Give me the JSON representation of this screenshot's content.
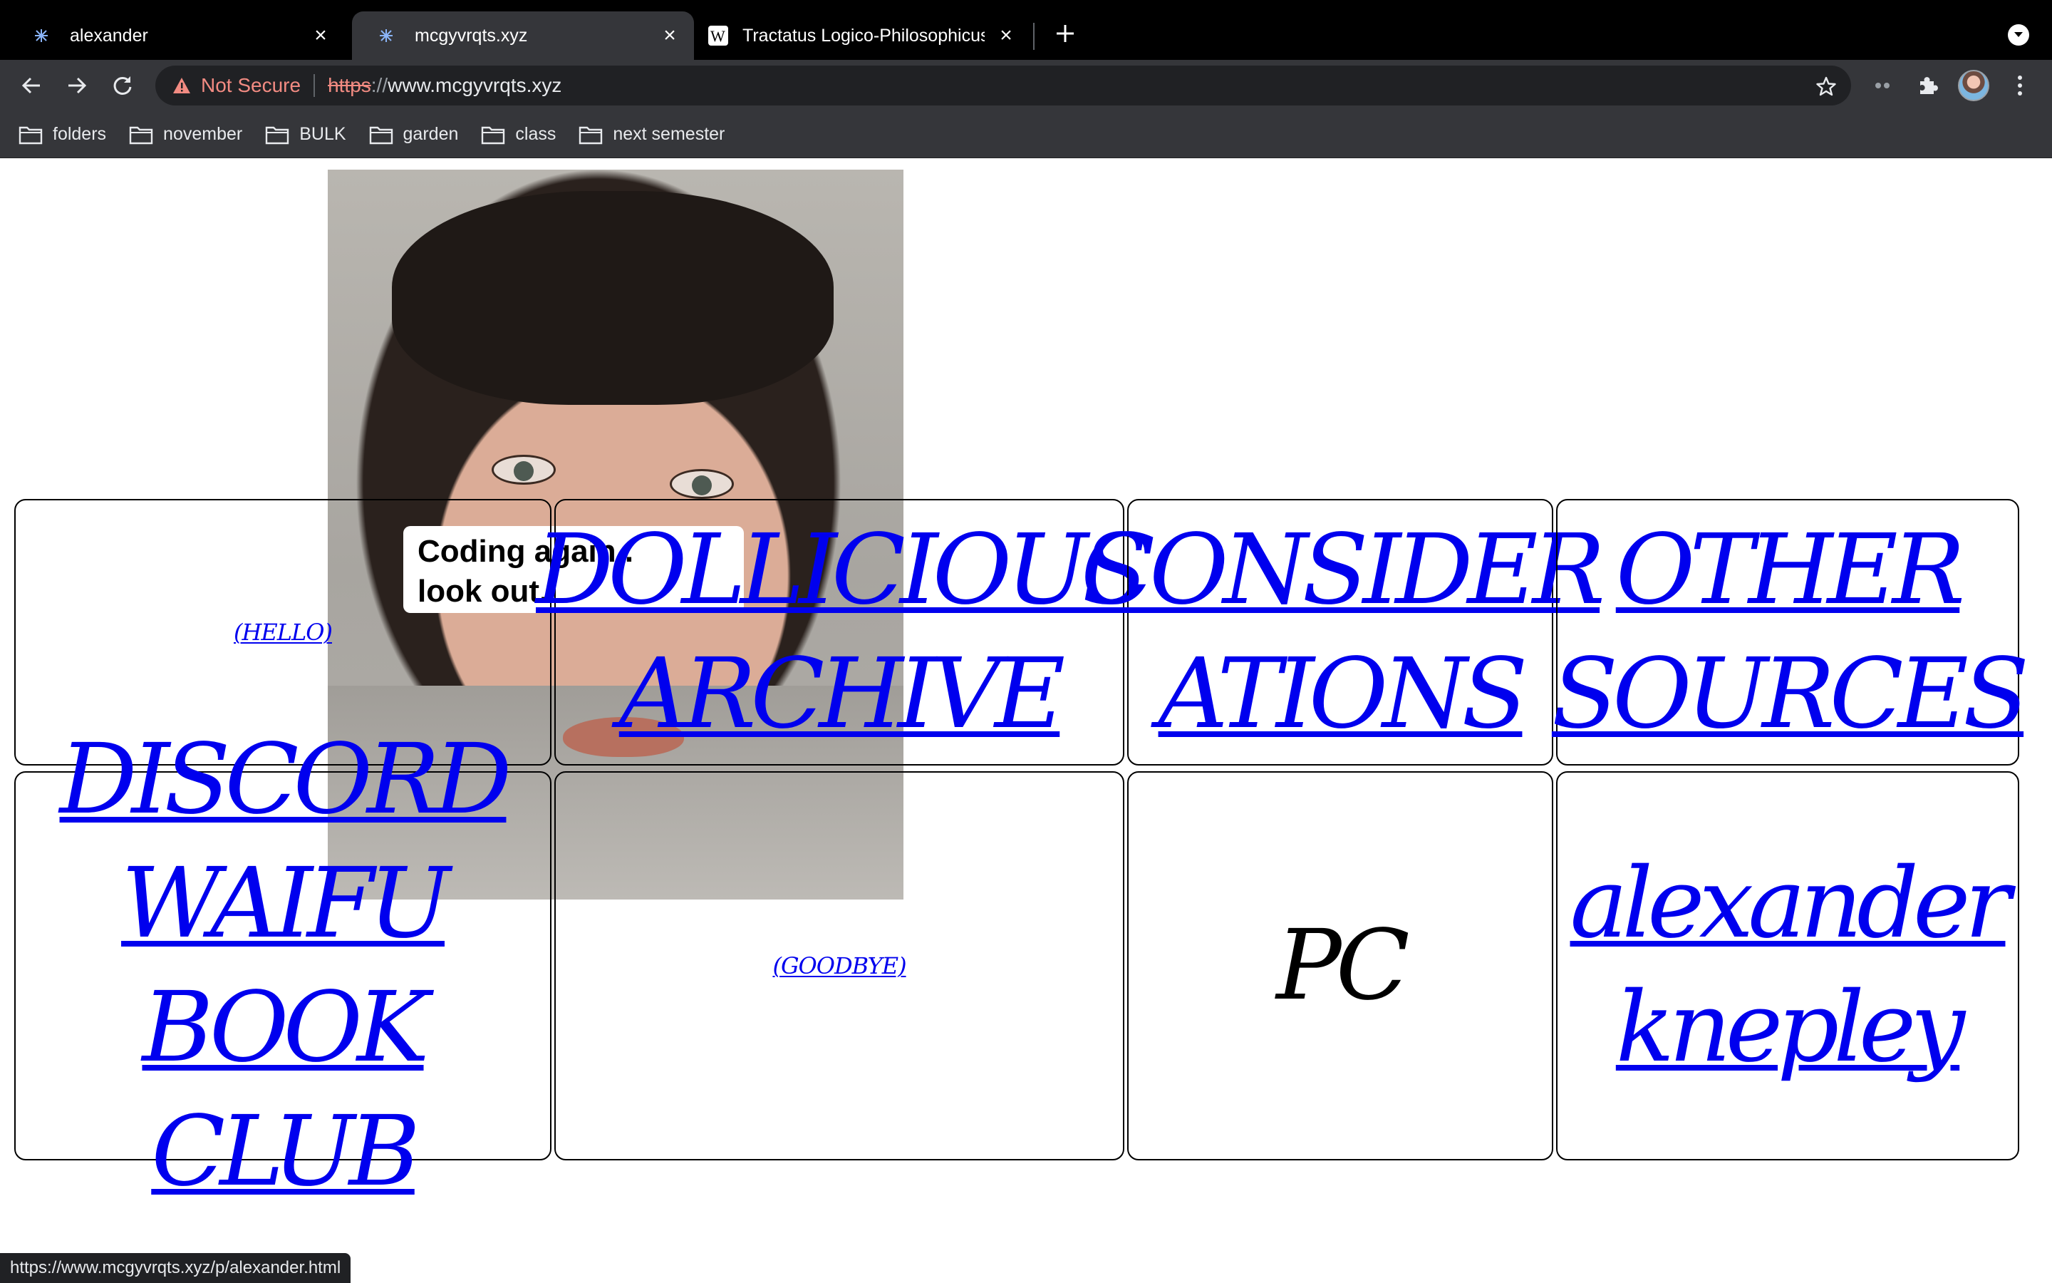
{
  "browser": {
    "tabs": [
      {
        "title": "alexander",
        "active": false
      },
      {
        "title": "mcgyvrqts.xyz",
        "active": true
      },
      {
        "title": "Tractatus Logico-Philosophicus",
        "active": false
      }
    ],
    "security_label": "Not Secure",
    "url_scheme": "https",
    "url_separator": "://",
    "url_host": "www.mcgyvrqts.xyz",
    "bookmarks": [
      "folders",
      "november",
      "BULK",
      "garden",
      "class",
      "next semester"
    ]
  },
  "page": {
    "photo_caption": "Coding again..\nlook out.",
    "grid": {
      "hello": "(HELLO)",
      "dollicious_archive": "DOLLICIOUS ARCHIVE",
      "considerations": "CONSIDER ATIONS",
      "other_sources": "OTHER SOURCES",
      "discord_waifu_book_club": "DISCORD WAIFU BOOK CLUB",
      "goodbye": "(GOODBYE)",
      "pc": "PC",
      "alexander_knepley": "alexander knepley"
    }
  },
  "status_url": "https://www.mcgyvrqts.xyz/p/alexander.html",
  "colors": {
    "link": "#0000ee",
    "visited_text": "#000000",
    "chrome_dark": "#35363a",
    "warning": "#f28b82"
  }
}
